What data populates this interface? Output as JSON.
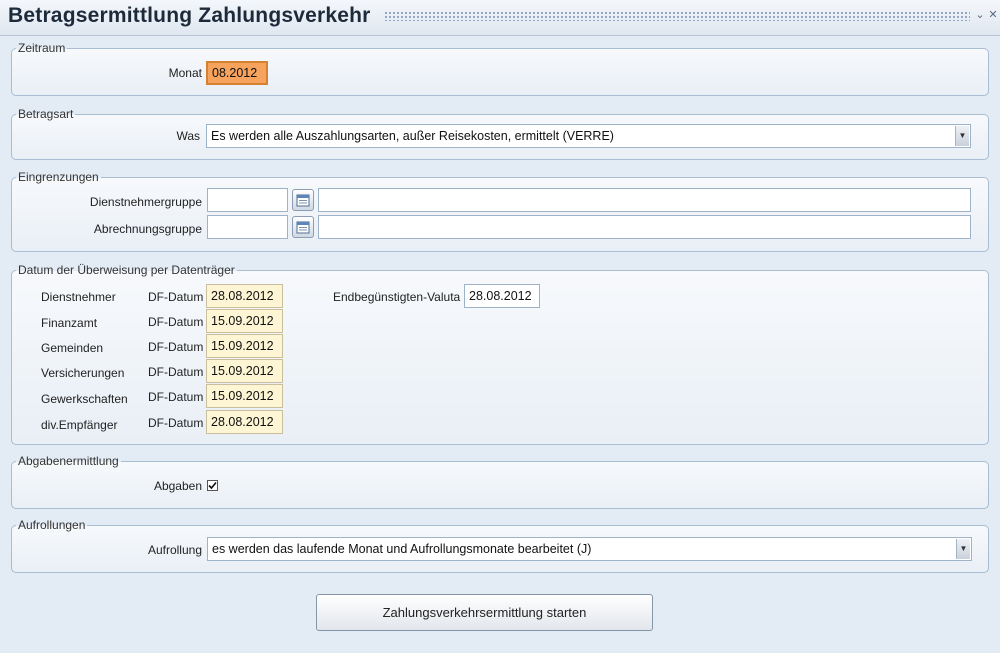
{
  "window": {
    "title": "Betragsermittlung Zahlungsverkehr",
    "minimize_glyph": "⌄",
    "close_glyph": "✕"
  },
  "zeitraum": {
    "legend": "Zeitraum",
    "monat_label": "Monat",
    "monat_value": "08.2012"
  },
  "betragsart": {
    "legend": "Betragsart",
    "was_label": "Was",
    "was_value": "Es werden alle Auszahlungsarten, außer Reisekosten, ermittelt (VERRE)"
  },
  "eingrenzungen": {
    "legend": "Eingrenzungen",
    "dienstnehmergruppe_label": "Dienstnehmergruppe",
    "dienstnehmergruppe_code": "",
    "dienstnehmergruppe_text": "",
    "abrechnungsgruppe_label": "Abrechnungsgruppe",
    "abrechnungsgruppe_code": "",
    "abrechnungsgruppe_text": ""
  },
  "datum": {
    "legend": "Datum der Überweisung per Datenträger",
    "rows": [
      {
        "label": "Dienstnehmer",
        "df_label": "DF-Datum",
        "value": "28.08.2012"
      },
      {
        "label": "Finanzamt",
        "df_label": "DF-Datum",
        "value": "15.09.2012"
      },
      {
        "label": "Gemeinden",
        "df_label": "DF-Datum",
        "value": "15.09.2012"
      },
      {
        "label": "Versicherungen",
        "df_label": "DF-Datum",
        "value": "15.09.2012"
      },
      {
        "label": "Gewerkschaften",
        "df_label": "DF-Datum",
        "value": "15.09.2012"
      },
      {
        "label": "div.Empfänger",
        "df_label": "DF-Datum",
        "value": "28.08.2012"
      }
    ],
    "valuta_label": "Endbegünstigten-Valuta",
    "valuta_value": "28.08.2012"
  },
  "abgaben": {
    "legend": "Abgabenermittlung",
    "label": "Abgaben",
    "checked": true
  },
  "aufrollungen": {
    "legend": "Aufrollungen",
    "label": "Aufrollung",
    "value": "es werden das laufende Monat und Aufrollungsmonate bearbeitet (J)"
  },
  "start_button": {
    "label": "Zahlungsverkehrsermittlung starten"
  },
  "icons": {
    "calendar": "calendar-icon",
    "dropdown": "dropdown-arrow-icon",
    "check": "checkmark-icon"
  },
  "colors": {
    "active_field": "#f5a35d",
    "date_field": "#fdf5d3",
    "border": "#a9bdd3"
  }
}
